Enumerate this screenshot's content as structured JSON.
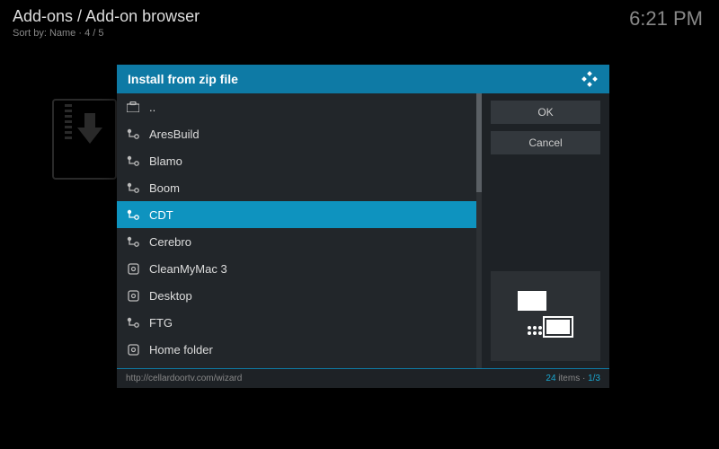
{
  "background": {
    "title": "Add-ons / Add-on browser",
    "sort": "Sort by: Name  ·  4 / 5",
    "clock": "6:21 PM"
  },
  "dialog": {
    "title": "Install from zip file",
    "buttons": {
      "ok": "OK",
      "cancel": "Cancel"
    },
    "footer": {
      "path": "http://cellardoortv.com/wizard",
      "count": "24",
      "count_suffix": " items  ·  ",
      "page": "1/3"
    }
  },
  "files": [
    {
      "label": "..",
      "icon": "briefcase",
      "selected": false
    },
    {
      "label": "AresBuild",
      "icon": "network-node",
      "selected": false
    },
    {
      "label": "Blamo",
      "icon": "network-node",
      "selected": false
    },
    {
      "label": "Boom",
      "icon": "network-node",
      "selected": false
    },
    {
      "label": "CDT",
      "icon": "network-node",
      "selected": true
    },
    {
      "label": "Cerebro",
      "icon": "network-node",
      "selected": false
    },
    {
      "label": "CleanMyMac 3",
      "icon": "disk",
      "selected": false
    },
    {
      "label": "Desktop",
      "icon": "disk",
      "selected": false
    },
    {
      "label": "FTG",
      "icon": "network-node",
      "selected": false
    },
    {
      "label": "Home folder",
      "icon": "disk",
      "selected": false
    }
  ]
}
